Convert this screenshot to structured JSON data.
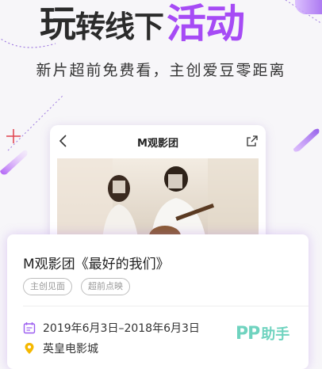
{
  "hero": {
    "title_part1": "玩",
    "title_part2": "转线下",
    "title_part3": "活动",
    "subtitle": "新片超前免费看，主创爱豆零距离"
  },
  "colors": {
    "accent": "#a64bf5",
    "text_dark": "#2b2b2b",
    "date_icon": "#9b5cf0",
    "location_icon": "#f5b800",
    "watermark": "#6fd3bf"
  },
  "phone_preview": {
    "back_icon": "chevron-left-icon",
    "title": "M观影团",
    "share_icon": "share-icon"
  },
  "event_card": {
    "title": "M观影团《最好的我们》",
    "tags": [
      "主创见面",
      "超前点映"
    ],
    "date_icon": "calendar-icon",
    "date": "2019年6月3日–2018年6月3日",
    "location_icon": "location-pin-icon",
    "location": "英皇电影城"
  },
  "watermark": {
    "latin": "PP",
    "chinese": "助手"
  }
}
